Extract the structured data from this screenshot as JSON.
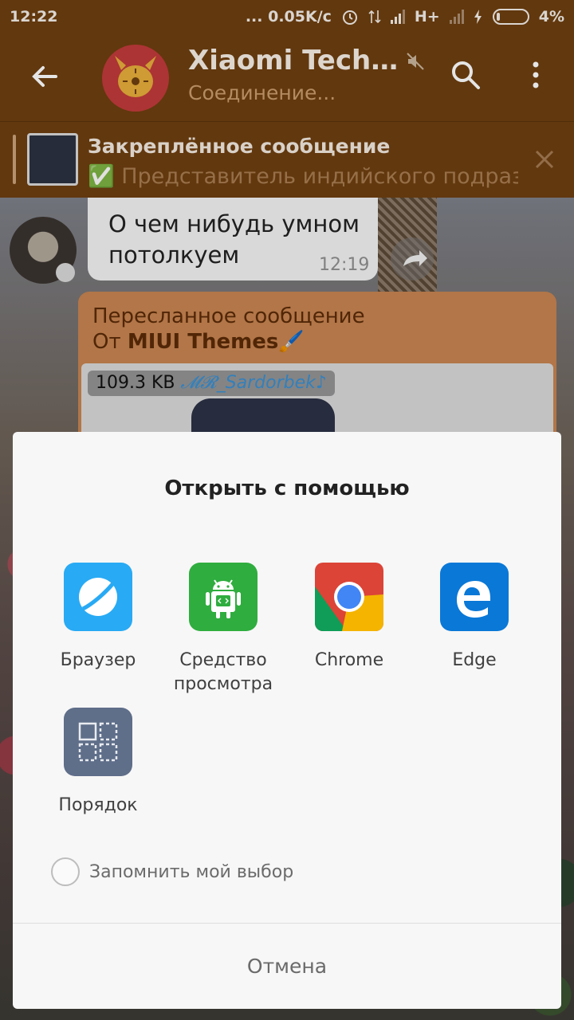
{
  "status_bar": {
    "time": "12:22",
    "net_speed": "... 0.05K/с",
    "network": "H+",
    "battery": "4%"
  },
  "header": {
    "title": "Xiaomi Technology",
    "subtitle": "Соединение..."
  },
  "pinned": {
    "title": "Закреплённое сообщение",
    "text": "✅ Представитель индийского подразделения"
  },
  "chat": {
    "message_text": "О чем нибудь умном потолкуем",
    "message_time": "12:19",
    "forwarded_header": "Пересланное сообщение",
    "forwarded_from_prefix": "От ",
    "forwarded_from_name": "MIUI Themes🖌️",
    "file_size": "109.3 KB",
    "file_author": "𝓜𝓡_Sardorbek♪"
  },
  "dialog": {
    "title": "Открыть с помощью",
    "apps": [
      {
        "label": "Браузер",
        "icon": "browser-icon",
        "color": "#29aaf4"
      },
      {
        "label": "Средство просмотра",
        "icon": "android-viewer-icon",
        "color": "#2fad3f"
      },
      {
        "label": "Chrome",
        "icon": "chrome-icon",
        "color": "#db4437"
      },
      {
        "label": "Edge",
        "icon": "edge-icon",
        "color": "#0a78d7"
      },
      {
        "label": "Порядок",
        "icon": "grid-icon",
        "color": "#5f6e89"
      }
    ],
    "remember_label": "Запомнить мой выбор",
    "cancel_label": "Отмена"
  },
  "colors": {
    "header_bg": "#6e3f10",
    "forwarded_bg": "#c78451",
    "dialog_bg": "#f7f7f7"
  }
}
